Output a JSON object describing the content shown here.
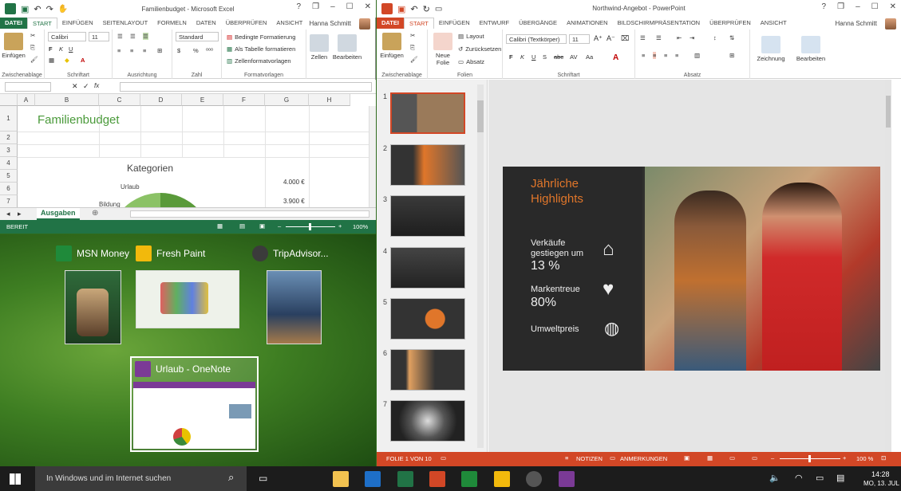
{
  "excel": {
    "title": "Familienbudget - Microsoft Excel",
    "window_controls": [
      "?",
      "❐",
      "–",
      "☐",
      "✕"
    ],
    "tabs": [
      "DATEI",
      "START",
      "EINFÜGEN",
      "SEITENLAYOUT",
      "FORMELN",
      "DATEN",
      "ÜBERPRÜFEN",
      "ANSICHT"
    ],
    "user": "Hanna Schmitt",
    "ribbon": {
      "einfuegen": "Einfügen",
      "font": "Calibri",
      "size": "11",
      "number_format": "Standard",
      "bedingte": "Bedingte Formatierung",
      "als_tabelle": "Als Tabelle formatieren",
      "zellenformat": "Zellenformatvorlagen",
      "zellen": "Zellen",
      "bearbeiten": "Bearbeiten",
      "groups": [
        "Zwischenablage",
        "Schriftart",
        "Ausrichtung",
        "Zahl",
        "Formatvorlagen"
      ]
    },
    "columns": [
      "A",
      "B",
      "C",
      "D",
      "E",
      "F",
      "G",
      "H"
    ],
    "rows": [
      "1",
      "2",
      "3",
      "4",
      "5",
      "6",
      "7"
    ],
    "cell_title": "Familienbudget",
    "chart_title": "Kategorien",
    "chart_label1": "Urlaub",
    "chart_label2": "Bildung",
    "values": [
      "4.000 €",
      "3.900 €"
    ],
    "sheet_tab": "Ausgaben",
    "status": "BEREIT",
    "zoom": "100%"
  },
  "taskview": {
    "apps": [
      {
        "label": "MSN Money",
        "color": "#1f8a3a"
      },
      {
        "label": "Fresh Paint",
        "color": "#f2b90c"
      },
      {
        "label": "TripAdvisor...",
        "color": "#3b3b3b"
      },
      {
        "label": "Urlaub - OneNote",
        "color": "#7b3a96"
      }
    ]
  },
  "ppt": {
    "title": "Northwind-Angebot - PowerPoint",
    "tabs": [
      "DATEI",
      "START",
      "EINFÜGEN",
      "ENTWURF",
      "ÜBERGÄNGE",
      "ANIMATIONEN",
      "BILDSCHIRMPRÄSENTATION",
      "ÜBERPRÜFEN",
      "ANSICHT"
    ],
    "user": "Hanna Schmitt",
    "ribbon": {
      "einfuegen": "Einfügen",
      "neue_folie": "Neue Folie",
      "layout": "Layout",
      "zurueck": "Zurücksetzen",
      "absatz": "Absatz",
      "font": "Calibri (Textkörper)",
      "size": "11",
      "zeichnung": "Zeichnung",
      "bearbeiten": "Bearbeiten",
      "groups": [
        "Zwischenablage",
        "Folien",
        "Schriftart",
        "Absatz"
      ]
    },
    "slide_numbers": [
      "1",
      "2",
      "3",
      "4",
      "5",
      "6",
      "7"
    ],
    "slide": {
      "heading": "Jährliche Highlights",
      "s1": "Verkäufe gestiegen um",
      "v1": "13 %",
      "s2": "Markentreue",
      "v2": "80%",
      "s3": "Umweltpreis"
    },
    "status": {
      "slide": "FOLIE 1 VON 10",
      "notes": "NOTIZEN",
      "comments": "ANMERKUNGEN",
      "zoom": "100 %"
    }
  },
  "taskbar": {
    "search": "In Windows und im Internet suchen",
    "time": "14:28",
    "date": "MO, 13. JUL"
  }
}
